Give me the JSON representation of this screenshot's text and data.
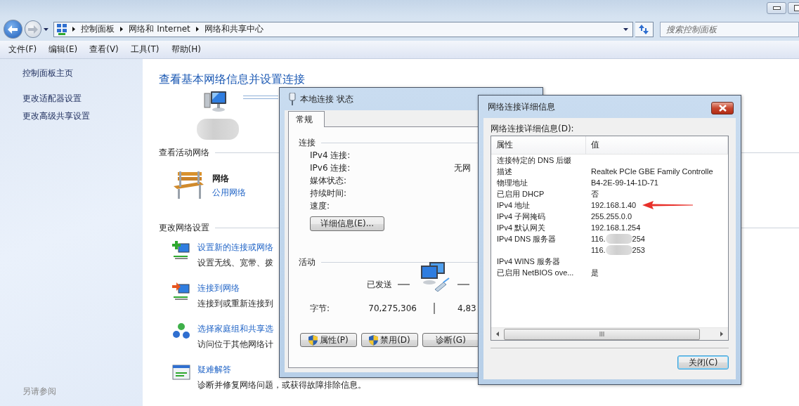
{
  "window": {
    "controls": [
      {
        "kind": "minimize"
      },
      {
        "kind": "maximize"
      }
    ]
  },
  "nav": {
    "back": {
      "disabled": false
    },
    "forward": {
      "disabled": true
    },
    "breadcrumb": [
      "控制面板",
      "网络和 Internet",
      "网络和共享中心"
    ],
    "search": {
      "placeholder": "搜索控制面板"
    }
  },
  "menu": [
    "文件(F)",
    "编辑(E)",
    "查看(V)",
    "工具(T)",
    "帮助(H)"
  ],
  "sidebar": {
    "links": [
      "控制面板主页",
      "更改适配器设置",
      "更改高级共享设置"
    ],
    "see_also": "另请参阅"
  },
  "main": {
    "title": "查看基本网络信息并设置连接",
    "active_networks": {
      "heading": "查看活动网络",
      "network": {
        "name": "网络",
        "type": "公用网络"
      }
    },
    "settings": {
      "heading": "更改网络设置",
      "items": [
        {
          "kind": "new-connection",
          "title": "设置新的连接或网络",
          "description": "设置无线、宽带、拨"
        },
        {
          "kind": "connect",
          "title": "连接到网络",
          "description": "连接到或重新连接到"
        },
        {
          "kind": "homegroup",
          "title": "选择家庭组和共享选",
          "description": "访问位于其他网络计"
        },
        {
          "kind": "troubleshoot",
          "title": "疑难解答",
          "description": "诊断并修复网络问题，或获得故障排除信息。"
        }
      ]
    }
  },
  "status_dialog": {
    "title": "本地连接 状态",
    "tabs": [
      {
        "label": "常规",
        "selected": true
      }
    ],
    "connection": {
      "heading": "连接",
      "rows": [
        {
          "label": "IPv4 连接:"
        },
        {
          "label": "IPv6 连接:",
          "value": "无网"
        },
        {
          "label": "媒体状态:"
        },
        {
          "label": "持续时间:"
        },
        {
          "label": "速度:"
        }
      ],
      "details_button": "详细信息(E)..."
    },
    "activity": {
      "heading": "活动",
      "sent_label": "已发送",
      "bytes_label": "字节:",
      "bytes_sent": "70,275,306",
      "bytes_received": "4,83"
    },
    "buttons": [
      {
        "label": "属性(P)",
        "shield": true
      },
      {
        "label": "禁用(D)",
        "shield": true
      },
      {
        "label": "诊断(G)",
        "shield": false
      }
    ]
  },
  "details_dialog": {
    "title": "网络连接详细信息",
    "list_label": "网络连接详细信息(D):",
    "columns": [
      "属性",
      "值"
    ],
    "rows": [
      {
        "property": "连接特定的 DNS 后缀"
      },
      {
        "property": "描述",
        "value": "Realtek PCIe GBE Family Controlle"
      },
      {
        "property": "物理地址",
        "value": "B4-2E-99-14-1D-71"
      },
      {
        "property": "已启用 DHCP",
        "value": "否"
      },
      {
        "property": "IPv4 地址",
        "value": "192.168.1.40",
        "marked": true
      },
      {
        "property": "IPv4 子网掩码",
        "value": "255.255.0.0"
      },
      {
        "property": "IPv4 默认网关",
        "value": "192.168.1.254"
      },
      {
        "property": "IPv4 DNS 服务器",
        "value_parts": [
          "116.",
          "254"
        ]
      },
      {
        "value_parts": [
          "116.",
          "253"
        ]
      },
      {
        "property": "IPv4 WINS 服务器"
      },
      {
        "property": "已启用 NetBIOS ove...",
        "value": "是"
      }
    ],
    "close_button": "关闭(C)"
  }
}
